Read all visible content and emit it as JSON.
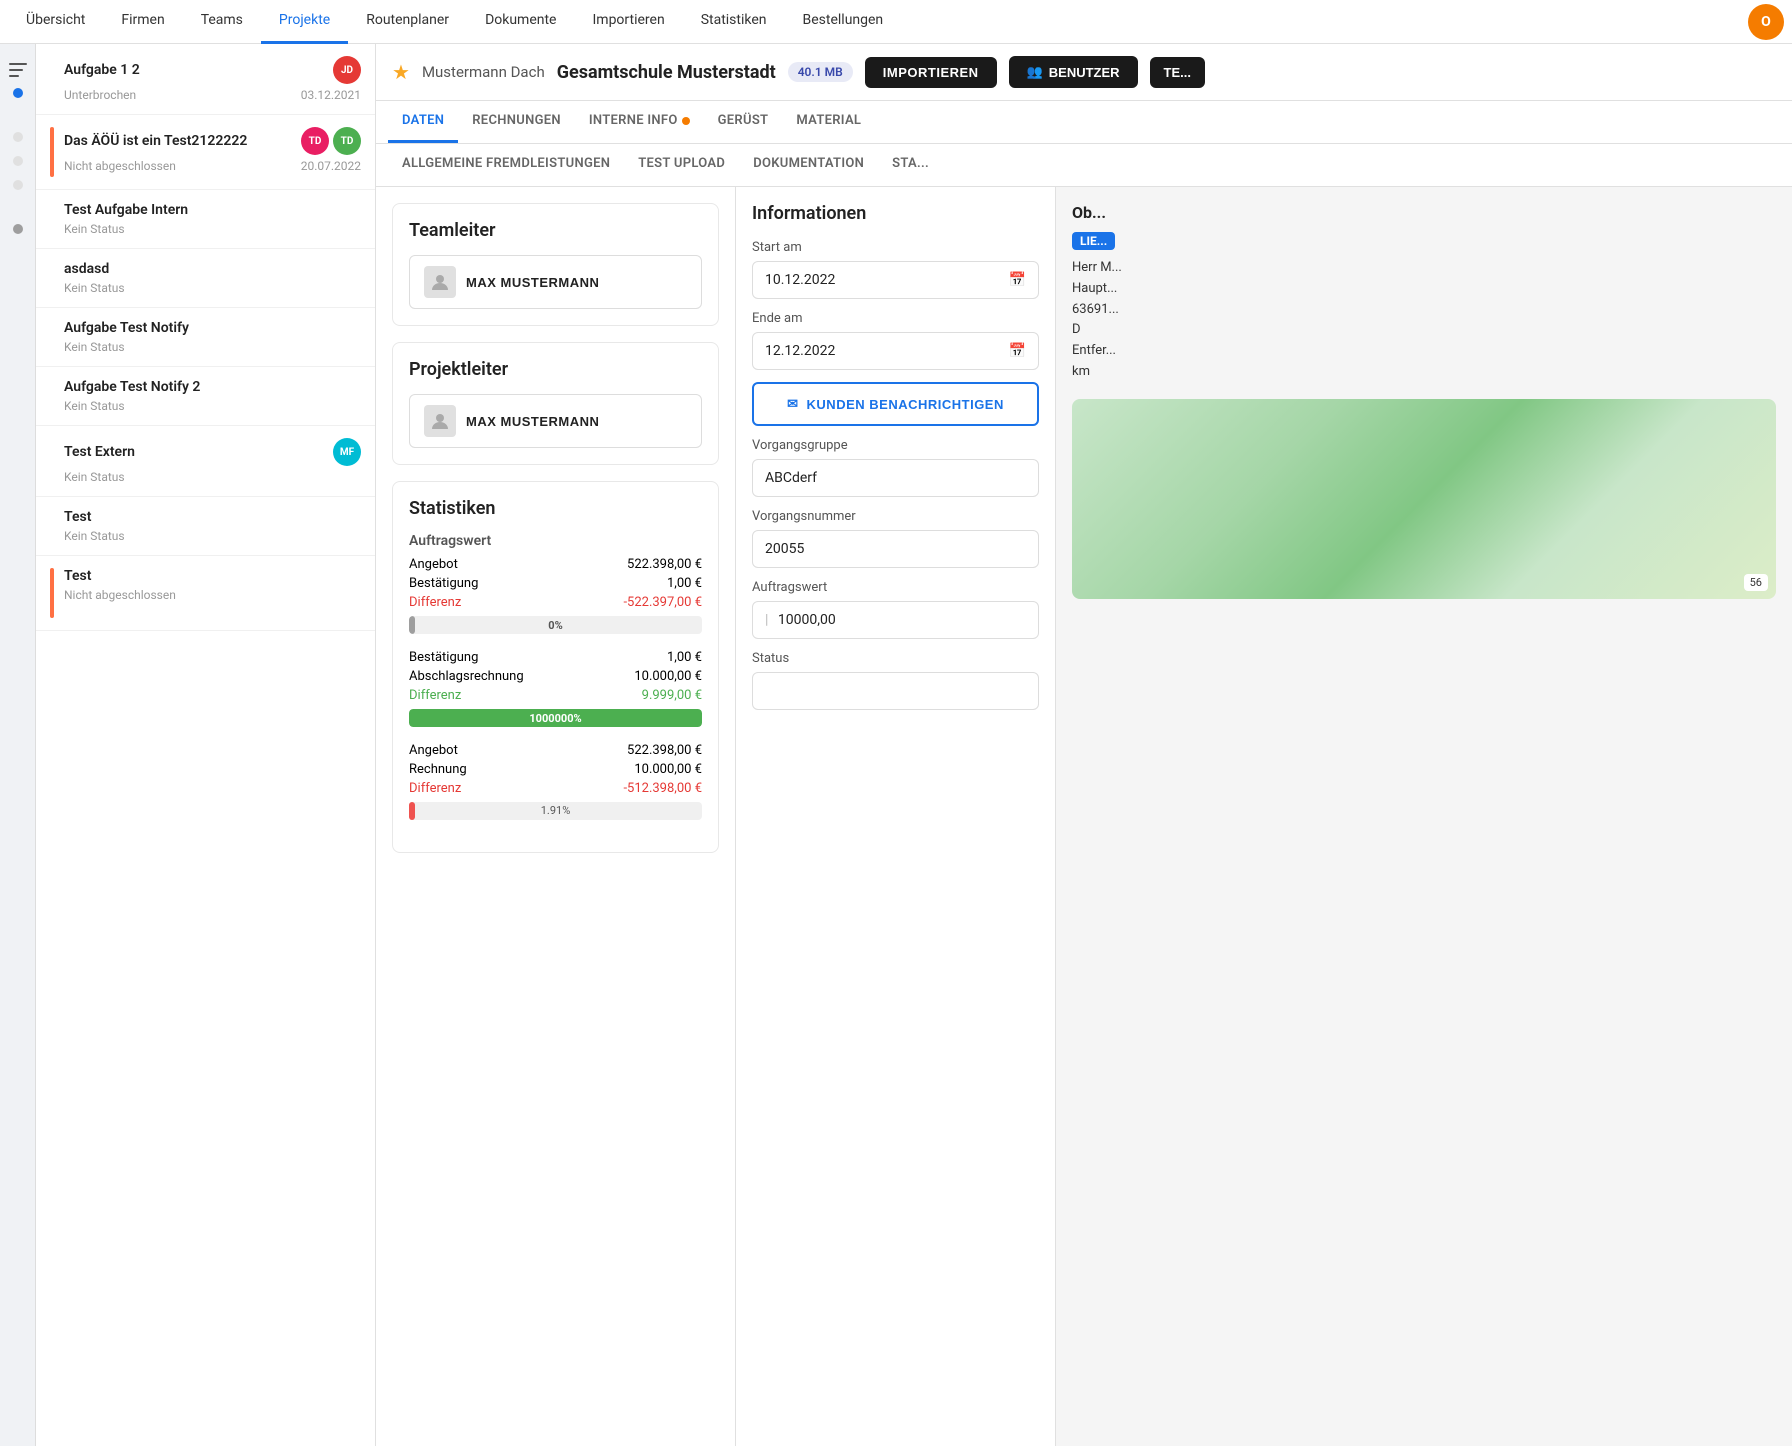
{
  "nav": {
    "items": [
      {
        "label": "Übersicht",
        "active": false
      },
      {
        "label": "Firmen",
        "active": false
      },
      {
        "label": "Teams",
        "active": false
      },
      {
        "label": "Projekte",
        "active": true
      },
      {
        "label": "Routenplaner",
        "active": false
      },
      {
        "label": "Dokumente",
        "active": false
      },
      {
        "label": "Importieren",
        "active": false
      },
      {
        "label": "Statistiken",
        "active": false
      },
      {
        "label": "Bestellungen",
        "active": false
      }
    ],
    "avatar_initials": "O"
  },
  "project_header": {
    "company": "Mustermann Dach",
    "project": "Gesamtschule Musterstadt",
    "file_size": "40.1 MB",
    "btn_import": "IMPORTIEREN",
    "btn_benutzer": "BENUTZER",
    "btn_te": "TE..."
  },
  "tabs1": [
    {
      "label": "DATEN",
      "active": true
    },
    {
      "label": "RECHNUNGEN",
      "active": false
    },
    {
      "label": "INTERNE INFO",
      "active": false,
      "dot": true
    },
    {
      "label": "GERÜST",
      "active": false
    },
    {
      "label": "MATERIAL",
      "active": false
    }
  ],
  "tabs2": [
    {
      "label": "ALLGEMEINE FREMDLEISTUNGEN",
      "active": false
    },
    {
      "label": "TEST UPLOAD",
      "active": false
    },
    {
      "label": "DOKUMENTATION",
      "active": false
    },
    {
      "label": "STA...",
      "active": false
    }
  ],
  "tasks": [
    {
      "title": "Aufgabe 1 2",
      "status": "Unterbrochen",
      "date": "03.12.2021",
      "badges": [
        {
          "initials": "JD",
          "color": "#e53935"
        }
      ],
      "bar_color": null
    },
    {
      "title": "Das ÄÖÜ ist ein Test2122222",
      "status": "Nicht abgeschlossen",
      "date": "20.07.2022",
      "badges": [
        {
          "initials": "TD",
          "color": "#e91e63"
        },
        {
          "initials": "TD",
          "color": "#4caf50"
        }
      ],
      "bar_color": "#ff7043"
    },
    {
      "title": "Test Aufgabe Intern",
      "status": "Kein Status",
      "date": "",
      "badges": [],
      "bar_color": null
    },
    {
      "title": "asdasd",
      "status": "Kein Status",
      "date": "",
      "badges": [],
      "bar_color": null
    },
    {
      "title": "Aufgabe Test Notify",
      "status": "Kein Status",
      "date": "",
      "badges": [],
      "bar_color": null
    },
    {
      "title": "Aufgabe Test Notify 2",
      "status": "Kein Status",
      "date": "",
      "badges": [],
      "bar_color": null
    },
    {
      "title": "Test Extern",
      "status": "Kein Status",
      "date": "",
      "badges": [
        {
          "initials": "MF",
          "color": "#00bcd4"
        }
      ],
      "bar_color": null
    },
    {
      "title": "Test",
      "status": "Kein Status",
      "date": "",
      "badges": [],
      "bar_color": null
    },
    {
      "title": "Test",
      "status": "Nicht abgeschlossen",
      "date": "",
      "badges": [],
      "bar_color": "#ff7043"
    }
  ],
  "teamleiter": {
    "title": "Teamleiter",
    "name": "MAX MUSTERMANN"
  },
  "projektleiter": {
    "title": "Projektleiter",
    "name": "MAX MUSTERMANN"
  },
  "statistiken": {
    "title": "Statistiken",
    "auftragswert_label": "Auftragswert",
    "groups": [
      {
        "rows": [
          {
            "label": "Angebot",
            "value": "522.398,00 €",
            "negative": false
          },
          {
            "label": "Bestätigung",
            "value": "1,00 €",
            "negative": false
          },
          {
            "label": "Differenz",
            "value": "-522.397,00 €",
            "negative": true
          }
        ],
        "progress": {
          "pct": 0,
          "label": "0%",
          "color": "#9e9e9e"
        }
      },
      {
        "rows": [
          {
            "label": "Bestätigung",
            "value": "1,00 €",
            "negative": false
          },
          {
            "label": "Abschlagsrechnung",
            "value": "10.000,00 €",
            "negative": false
          },
          {
            "label": "Differenz",
            "value": "9.999,00 €",
            "negative": false,
            "green": true
          }
        ],
        "progress": {
          "pct": 100,
          "label": "1000000%",
          "color": "#4caf50"
        }
      },
      {
        "rows": [
          {
            "label": "Angebot",
            "value": "522.398,00 €",
            "negative": false
          },
          {
            "label": "Rechnung",
            "value": "10.000,00 €",
            "negative": false
          },
          {
            "label": "Differenz",
            "value": "-512.398,00 €",
            "negative": true
          }
        ],
        "progress": {
          "pct": 2,
          "label": "1.91%",
          "color": "#ef5350"
        }
      }
    ]
  },
  "informationen": {
    "title": "Informationen",
    "start_label": "Start am",
    "start_value": "10.12.2022",
    "ende_label": "Ende am",
    "ende_value": "12.12.2022",
    "btn_kunden": "KUNDEN BENACHRICHTIGEN",
    "vorgangsgruppe_label": "Vorgangsgruppe",
    "vorgangsgruppe_value": "ABCderf",
    "vorgangsnummer_label": "Vorgangsnummer",
    "vorgangsnummer_value": "20055",
    "auftragswert_label": "Auftragswert",
    "auftragswert_value": "10000,00",
    "status_label": "Status"
  },
  "far_right": {
    "title": "Ob...",
    "addr_badge": "LIE...",
    "address": "Herr M...\nHaupt...\n63691...\nD\nEntfer...\nkm"
  },
  "icons": {
    "filter": "▼",
    "star": "★",
    "import_icon": "⬆",
    "users_icon": "👥",
    "calendar_icon": "📅",
    "envelope_icon": "✉"
  }
}
